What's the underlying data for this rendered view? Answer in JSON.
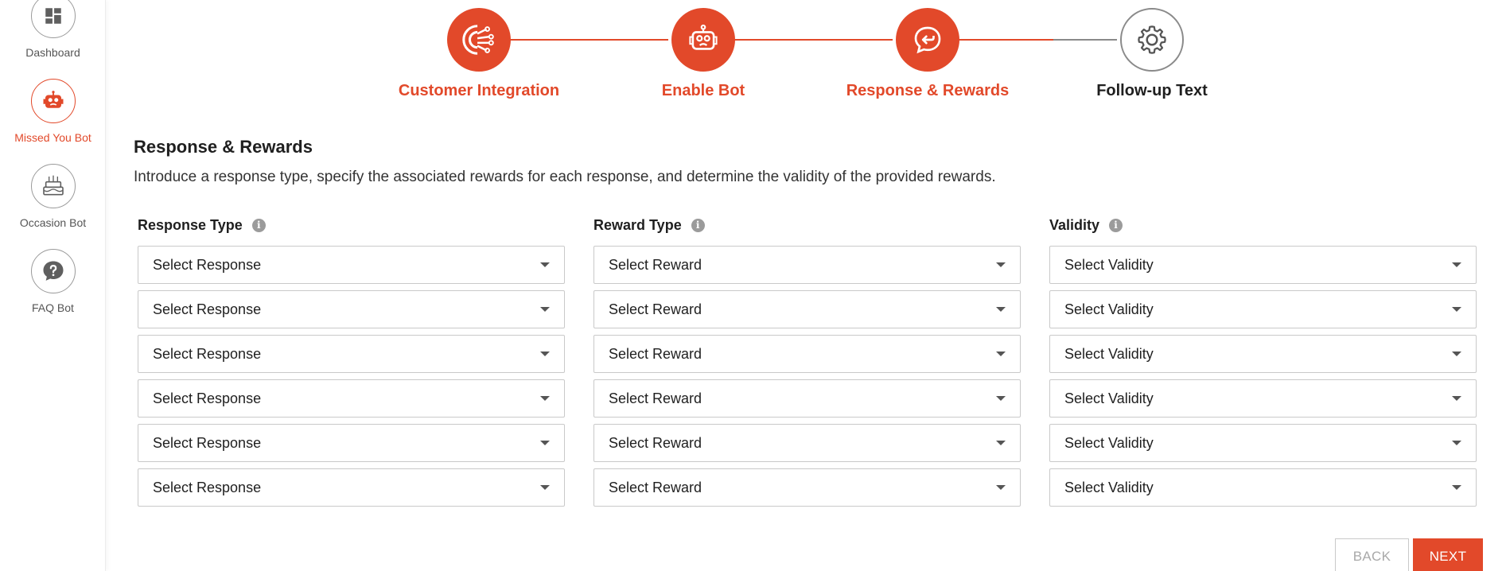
{
  "sidebar": {
    "items": [
      {
        "label": "Dashboard",
        "icon": "dashboard-icon",
        "active": false
      },
      {
        "label": "Missed You Bot",
        "icon": "robot-icon",
        "active": true
      },
      {
        "label": "Occasion Bot",
        "icon": "cake-icon",
        "active": false
      },
      {
        "label": "FAQ Bot",
        "icon": "question-icon",
        "active": false
      }
    ]
  },
  "stepper": {
    "steps": [
      {
        "label": "Customer Integration",
        "icon": "integration-icon",
        "state": "done"
      },
      {
        "label": "Enable Bot",
        "icon": "robot-icon",
        "state": "done"
      },
      {
        "label": "Response & Rewards",
        "icon": "chat-reply-icon",
        "state": "current"
      },
      {
        "label": "Follow-up Text",
        "icon": "gear-icon",
        "state": "pending"
      }
    ]
  },
  "section": {
    "title": "Response & Rewards",
    "description": "Introduce a response type, specify the associated rewards for each response, and determine the validity of the provided rewards."
  },
  "columns": [
    {
      "label": "Response Type",
      "info": "i",
      "placeholder": "Select Response",
      "rows": [
        "Select Response",
        "Select Response",
        "Select Response",
        "Select Response",
        "Select Response",
        "Select Response"
      ]
    },
    {
      "label": "Reward Type",
      "info": "i",
      "placeholder": "Select Reward",
      "rows": [
        "Select Reward",
        "Select Reward",
        "Select Reward",
        "Select Reward",
        "Select Reward",
        "Select Reward"
      ]
    },
    {
      "label": "Validity",
      "info": "i",
      "placeholder": "Select Validity",
      "rows": [
        "Select Validity",
        "Select Validity",
        "Select Validity",
        "Select Validity",
        "Select Validity",
        "Select Validity"
      ]
    }
  ],
  "buttons": {
    "back": "BACK",
    "next": "NEXT"
  },
  "colors": {
    "accent": "#e2492a",
    "inactive_border": "#8a8a8a"
  }
}
